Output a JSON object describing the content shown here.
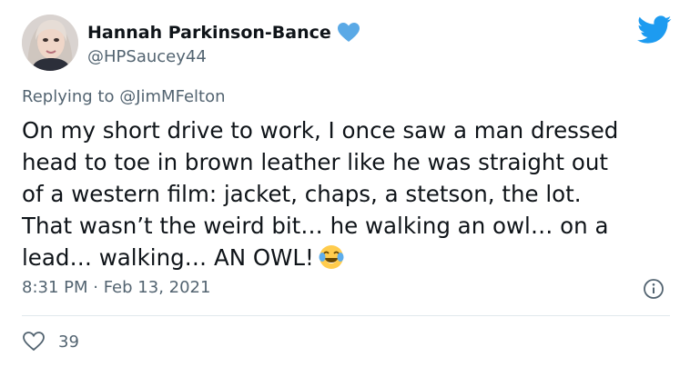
{
  "author": {
    "display_name": "Hannah Parkinson-Bance",
    "handle": "@HPSaucey44",
    "avatar_icon": "profile-photo",
    "verified_icon": "blue-heart-icon"
  },
  "reply": {
    "prefix": "Replying to ",
    "mention": "@JimMFelton"
  },
  "tweet": {
    "lines": [
      "On my short drive to work, I once saw a man dressed",
      "head to toe in brown leather like he was straight out",
      "of a western film: jacket, chaps, a stetson, the lot.",
      "That wasn’t the weird bit… he walking an owl… on a",
      "lead… walking… AN OWL!"
    ],
    "emoji": "face-with-tears-of-joy-emoji"
  },
  "meta": {
    "timestamp": "8:31 PM · Feb 13, 2021"
  },
  "stats": {
    "likes": "39"
  },
  "colors": {
    "twitter_blue": "#1d9bf0",
    "text_primary": "#0f1419",
    "text_secondary": "#536471",
    "divider": "#e1e8ed"
  }
}
